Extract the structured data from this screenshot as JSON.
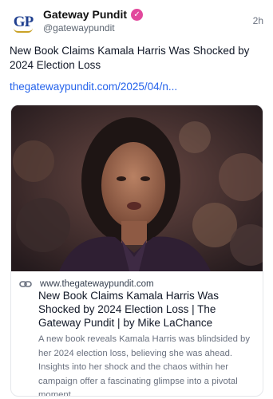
{
  "account": {
    "display_name": "Gateway Pundit",
    "handle": "@gatewaypundit",
    "avatar_text": "GP",
    "verified_glyph": "✓",
    "timestamp": "2h"
  },
  "post": {
    "text": "New Book Claims Kamala Harris Was Shocked by 2024 Election Loss",
    "link": "thegatewaypundit.com/2025/04/n..."
  },
  "link_card": {
    "domain": "www.thegatewaypundit.com",
    "title": "New Book Claims Kamala Harris Was Shocked by 2024 Election Loss | The Gateway Pundit | by Mike LaChance",
    "description": "A new book reveals Kamala Harris was blindsided by her 2024 election loss, believing she was ahead. Insights into her shock and the chaos within her campaign offer a fascinating glimpse into a pivotal moment.",
    "icon": "link-icon"
  },
  "colors": {
    "link": "#2563eb",
    "verified_badge": "#e2489c",
    "avatar_blue": "#1f3f8f",
    "avatar_gold": "#c9a227"
  }
}
